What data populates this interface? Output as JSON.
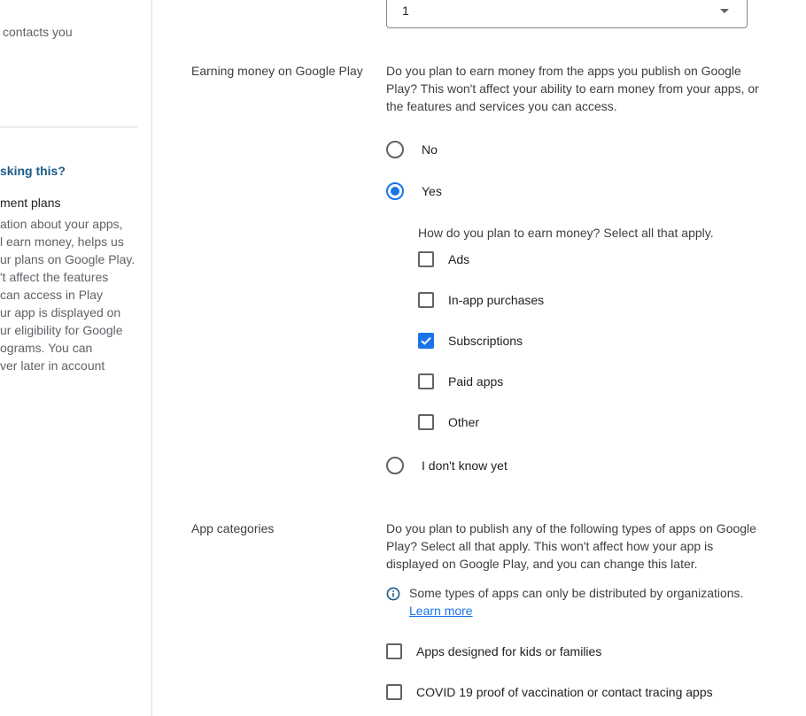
{
  "help_panel": {
    "top_text": "contacts you",
    "question": "sking this?",
    "subhead": "ment plans",
    "body_lines": [
      "ation about your apps,",
      "l earn money, helps us",
      "ur plans on Google Play.",
      "'t affect the features",
      "can access in Play",
      "ur app is displayed on",
      "ur eligibility for Google",
      "ograms. You can",
      "ver later in account"
    ]
  },
  "dropdown": {
    "value": "1"
  },
  "earning": {
    "label": "Earning money on Google Play",
    "description_lines": [
      "Do you plan to earn money from the apps you publish on Google",
      "Play? This won't affect your ability to earn money from your apps, or",
      "the features and services you can access."
    ],
    "options": [
      {
        "label": "No",
        "selected": false
      },
      {
        "label": "Yes",
        "selected": true
      },
      {
        "label": "I don't know yet",
        "selected": false
      }
    ],
    "sub_question": "How do you plan to earn money? Select all that apply.",
    "methods": [
      {
        "label": "Ads",
        "checked": false
      },
      {
        "label": "In-app purchases",
        "checked": false
      },
      {
        "label": "Subscriptions",
        "checked": true
      },
      {
        "label": "Paid apps",
        "checked": false
      },
      {
        "label": "Other",
        "checked": false
      }
    ]
  },
  "categories": {
    "label": "App categories",
    "description_lines": [
      "Do you plan to publish any of the following types of apps on Google",
      "Play? Select all that apply. This won't affect how your app is",
      "displayed on Google Play, and you can change this later."
    ],
    "info_text": "Some types of apps can only be distributed by organizations.",
    "learn_more": "Learn more",
    "items": [
      {
        "label": "Apps designed for kids or families",
        "checked": false
      },
      {
        "label": "COVID 19 proof of vaccination or contact tracing apps",
        "checked": false
      }
    ]
  },
  "colors": {
    "accent": "#1a73e8",
    "help_link": "#1a5b86"
  }
}
